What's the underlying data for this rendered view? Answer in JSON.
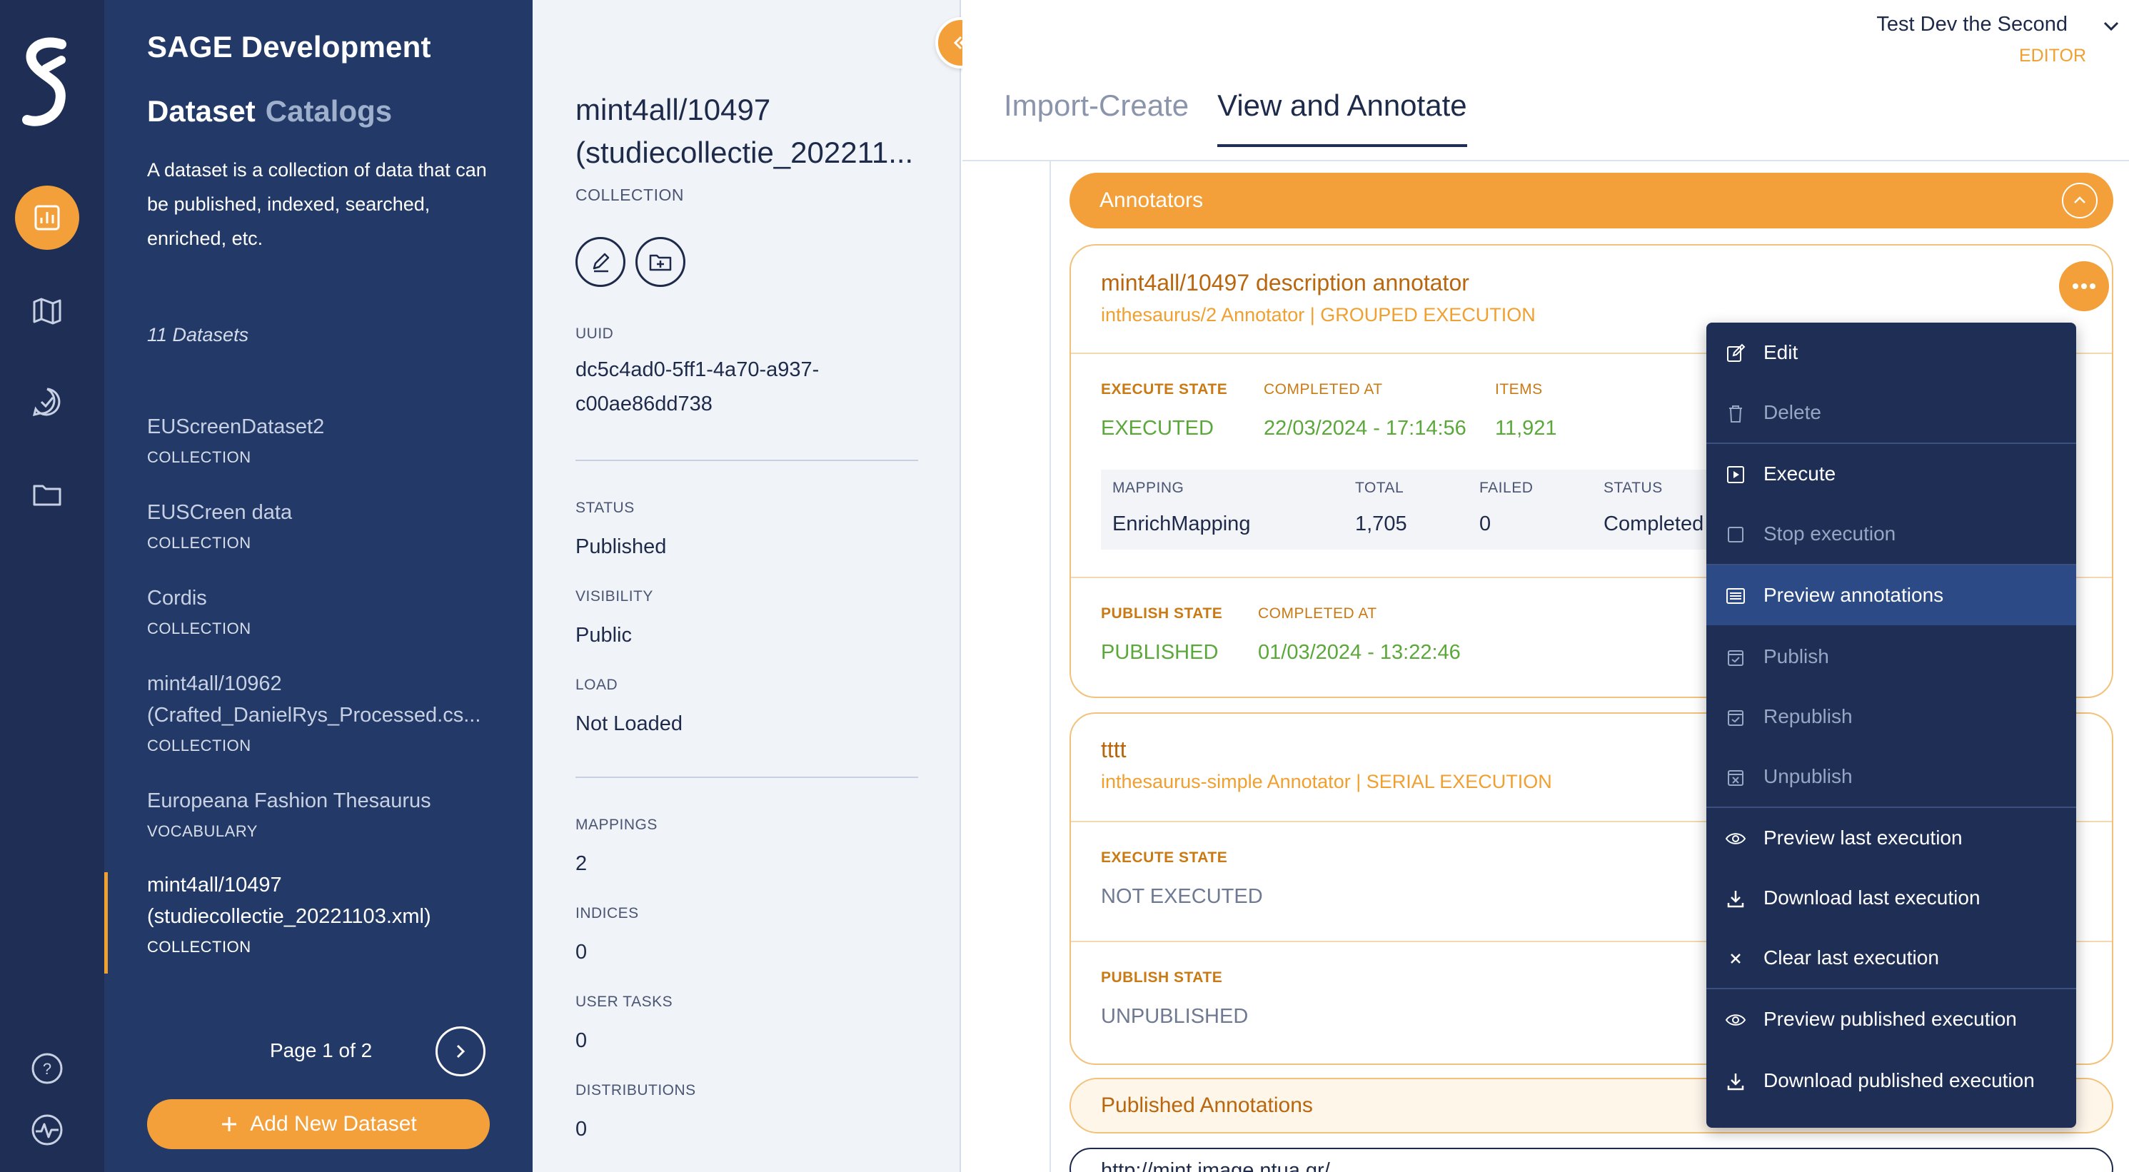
{
  "colors": {
    "rail": "#1e2e55",
    "list_panel": "#233a68",
    "accent": "#f3a03b",
    "details_bg": "#f0f3f8",
    "menu_bg": "#1e2e55",
    "success": "#5aa83a"
  },
  "rail": {
    "icons": [
      "sage-logo",
      "dashboard-icon",
      "map-icon",
      "check-circle-icon",
      "folder-icon",
      "help-icon",
      "activity-icon"
    ]
  },
  "list": {
    "brand": "SAGE Development",
    "subtitle_primary": "Dataset",
    "subtitle_secondary": "Catalogs",
    "intro": "A dataset is a collection of data that can be published, indexed, searched, enriched, etc.",
    "count": "11 Datasets",
    "items": [
      {
        "name": "EUScreenDataset2",
        "type": "COLLECTION"
      },
      {
        "name": "EUSCreen data",
        "type": "COLLECTION"
      },
      {
        "name": "Cordis",
        "type": "COLLECTION"
      },
      {
        "name_line1": "mint4all/10962",
        "name_line2": "(Crafted_DanielRys_Processed.cs...",
        "type": "COLLECTION"
      },
      {
        "name": "Europeana Fashion Thesaurus",
        "type": "VOCABULARY"
      },
      {
        "name_line1": "mint4all/10497",
        "name_line2": "(studiecollectie_20221103.xml)",
        "type": "COLLECTION"
      }
    ],
    "pager": "Page 1 of 2",
    "add_button": "Add New Dataset"
  },
  "details": {
    "title_line1": "mint4all/10497",
    "title_line2": "(studiecollectie_202211...",
    "kind": "COLLECTION",
    "uuid_label": "UUID",
    "uuid_line1": "dc5c4ad0-5ff1-4a70-a937-",
    "uuid_line2": "c00ae86dd738",
    "status_label": "STATUS",
    "status": "Published",
    "visibility_label": "VISIBILITY",
    "visibility": "Public",
    "load_label": "LOAD",
    "load": "Not Loaded",
    "mappings_label": "MAPPINGS",
    "mappings": "2",
    "indices_label": "INDICES",
    "indices": "0",
    "user_tasks_label": "USER TASKS",
    "user_tasks": "0",
    "distributions_label": "DISTRIBUTIONS",
    "distributions": "0"
  },
  "user": {
    "name": "Test Dev the Second",
    "role": "EDITOR"
  },
  "tabs": [
    {
      "label": "Import-Create",
      "active": false
    },
    {
      "label": "View and Annotate",
      "active": true
    }
  ],
  "annotators": {
    "header": "Annotators",
    "card1": {
      "title": "mint4all/10497 description annotator",
      "subtitle": "inthesaurus/2 Annotator | GROUPED EXECUTION",
      "execute_state_label": "EXECUTE STATE",
      "execute_state": "EXECUTED",
      "completed_at_label": "COMPLETED AT",
      "completed_at": "22/03/2024 - 17:14:56",
      "items_label": "ITEMS",
      "items": "11,921",
      "table": {
        "headers": [
          "MAPPING",
          "TOTAL",
          "FAILED",
          "STATUS"
        ],
        "row": [
          "EnrichMapping",
          "1,705",
          "0",
          "Completed"
        ]
      },
      "publish_state_label": "PUBLISH STATE",
      "publish_state": "PUBLISHED",
      "publish_completed_label": "COMPLETED AT",
      "publish_completed_at": "01/03/2024 - 13:22:46"
    },
    "card2": {
      "title": "tttt",
      "subtitle": "inthesaurus-simple Annotator | SERIAL EXECUTION",
      "execute_state_label": "EXECUTE STATE",
      "execute_state": "NOT EXECUTED",
      "publish_state_label": "PUBLISH STATE",
      "publish_state": "UNPUBLISHED"
    },
    "published_header": "Published Annotations",
    "bottom_text": "http://mint.image.ntua.gr/..."
  },
  "menu": {
    "items": [
      {
        "label": "Edit",
        "icon": "edit-icon",
        "disabled": false
      },
      {
        "label": "Delete",
        "icon": "trash-icon",
        "disabled": true
      },
      {
        "label": "Execute",
        "icon": "play-icon",
        "disabled": false
      },
      {
        "label": "Stop execution",
        "icon": "stop-icon",
        "disabled": true
      },
      {
        "label": "Preview annotations",
        "icon": "list-icon",
        "disabled": false,
        "highlighted": true
      },
      {
        "label": "Publish",
        "icon": "calendar-check-icon",
        "disabled": true
      },
      {
        "label": "Republish",
        "icon": "calendar-check-icon",
        "disabled": true
      },
      {
        "label": "Unpublish",
        "icon": "calendar-x-icon",
        "disabled": true
      },
      {
        "label": "Preview last execution",
        "icon": "eye-icon",
        "disabled": false
      },
      {
        "label": "Download last execution",
        "icon": "download-icon",
        "disabled": false
      },
      {
        "label": "Clear last execution",
        "icon": "close-icon",
        "disabled": false
      },
      {
        "label": "Preview published execution",
        "icon": "eye-icon",
        "disabled": false
      },
      {
        "label": "Download published execution",
        "icon": "download-icon",
        "disabled": false
      }
    ]
  }
}
